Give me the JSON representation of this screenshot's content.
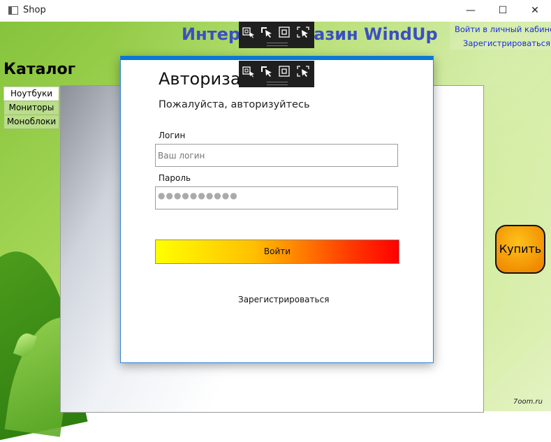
{
  "window": {
    "title": "Shop",
    "controls": {
      "minimize": "—",
      "maximize": "☐",
      "close": "✕"
    }
  },
  "header": {
    "store_title": "Интернет-магазин WindUp",
    "account_link": "Войти в личный кабинет",
    "register_link": "Зарегистрироваться"
  },
  "catalog": {
    "title": "Каталог",
    "tabs": [
      {
        "label": "Ноутбуки",
        "active": true
      },
      {
        "label": "Мониторы",
        "active": false
      },
      {
        "label": "Моноблоки",
        "active": false
      }
    ]
  },
  "buy_button": {
    "label": "Купить"
  },
  "watermark": "7oom.ru",
  "login_dialog": {
    "title": "Авторизация",
    "subtitle": "Пожалуйста, авторизуйтесь",
    "login_label": "Логин",
    "login_placeholder": "Ваш логин",
    "password_label": "Пароль",
    "password_value": "●●●●●●●●●●",
    "submit_label": "Войти",
    "register_link": "Зарегистрироваться"
  },
  "design_toolbar": {
    "icons": [
      "select-element-icon",
      "select-cursor-icon",
      "layout-adorners-icon",
      "track-focus-icon"
    ]
  },
  "colors": {
    "accent_blue": "#0a78d4",
    "store_title": "#3b4fc1",
    "link_blue": "#1a2de0",
    "buy_orange": "#f08a00"
  }
}
